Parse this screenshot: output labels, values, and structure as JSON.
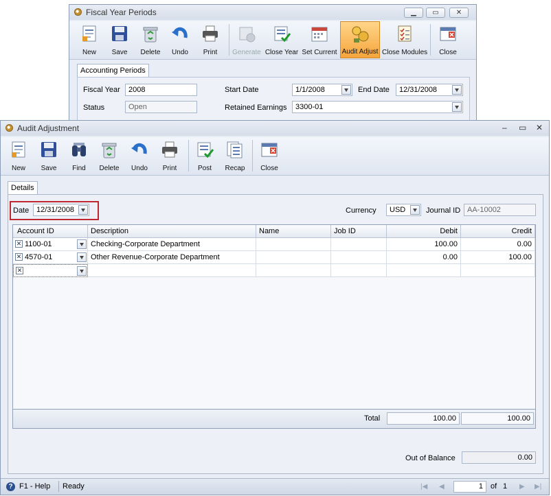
{
  "fiscal_window": {
    "title": "Fiscal Year Periods",
    "toolbar": [
      {
        "label": "New",
        "icon": "new-document-icon"
      },
      {
        "label": "Save",
        "icon": "floppy-disk-icon"
      },
      {
        "label": "Delete",
        "icon": "recycle-bin-icon"
      },
      {
        "label": "Undo",
        "icon": "undo-arrow-icon"
      },
      {
        "label": "Print",
        "icon": "printer-icon"
      },
      {
        "label": "Generate",
        "icon": "generate-calendar-icon"
      },
      {
        "label": "Close Year",
        "icon": "close-year-icon"
      },
      {
        "label": "Set Current",
        "icon": "calendar-icon"
      },
      {
        "label": "Audit Adjust",
        "icon": "audit-adjust-icon"
      },
      {
        "label": "Close Modules",
        "icon": "checklist-icon"
      },
      {
        "label": "Close",
        "icon": "close-window-icon"
      }
    ],
    "tab_label": "Accounting Periods",
    "fiscal_year_label": "Fiscal Year",
    "fiscal_year_value": "2008",
    "status_label": "Status",
    "status_value": "Open",
    "start_date_label": "Start Date",
    "start_date_value": "1/1/2008",
    "end_date_label": "End Date",
    "end_date_value": "12/31/2008",
    "retained_label": "Retained Earnings",
    "retained_value": "3300-01"
  },
  "audit_window": {
    "title": "Audit Adjustment",
    "toolbar": [
      {
        "label": "New",
        "icon": "new-document-icon"
      },
      {
        "label": "Save",
        "icon": "floppy-disk-icon"
      },
      {
        "label": "Find",
        "icon": "binoculars-icon"
      },
      {
        "label": "Delete",
        "icon": "recycle-bin-icon"
      },
      {
        "label": "Undo",
        "icon": "undo-arrow-icon"
      },
      {
        "label": "Print",
        "icon": "printer-icon"
      },
      {
        "label": "Post",
        "icon": "post-icon"
      },
      {
        "label": "Recap",
        "icon": "recap-icon"
      },
      {
        "label": "Close",
        "icon": "close-window-icon"
      }
    ],
    "tab_label": "Details",
    "date_label": "Date",
    "date_value": "12/31/2008",
    "currency_label": "Currency",
    "currency_value": "USD",
    "journal_label": "Journal ID",
    "journal_value": "AA-10002",
    "grid": {
      "headers": [
        "Account ID",
        "Description",
        "Name",
        "Job ID",
        "Debit",
        "Credit"
      ],
      "rows": [
        {
          "account": "1100-01",
          "description": "Checking-Corporate Department",
          "name": "",
          "job": "",
          "debit": "100.00",
          "credit": "0.00"
        },
        {
          "account": "4570-01",
          "description": "Other Revenue-Corporate Department",
          "name": "",
          "job": "",
          "debit": "0.00",
          "credit": "100.00"
        }
      ],
      "total_label": "Total",
      "total_debit": "100.00",
      "total_credit": "100.00"
    },
    "out_of_balance_label": "Out of Balance",
    "out_of_balance_value": "0.00",
    "status": {
      "help": "F1 - Help",
      "state": "Ready",
      "page": "1",
      "of_label": "of",
      "total_pages": "1"
    }
  },
  "colors": {
    "accent": "#f6a53b",
    "highlight_border": "#c0262e",
    "window_bg": "#e9eef6"
  }
}
